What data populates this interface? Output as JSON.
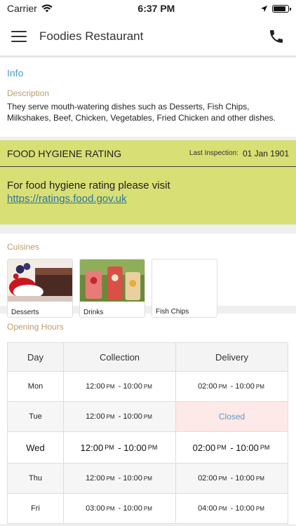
{
  "status": {
    "carrier": "Carrier",
    "time": "6:37 PM",
    "battery_level": 0.85
  },
  "nav": {
    "title": "Foodies Restaurant"
  },
  "info": {
    "title": "Info",
    "description_label": "Description",
    "description_text": "They serve mouth-watering dishes such as Desserts, Fish  Chips, Milkshakes, Beef, Chicken, Vegetables, Fried Chicken and other dishes."
  },
  "hygiene": {
    "title": "FOOD HYGIENE RATING",
    "inspection_label": "Last Inspection:",
    "inspection_date": "01 Jan 1901",
    "message": "For food hygiene rating please visit",
    "link": "https://ratings.food.gov.uk"
  },
  "cuisines": {
    "title": "Cuisines",
    "items": [
      {
        "label": "Desserts"
      },
      {
        "label": "Drinks"
      },
      {
        "label": "Fish  Chips"
      }
    ]
  },
  "hours": {
    "title": "Opening Hours",
    "headers": {
      "day": "Day",
      "collection": "Collection",
      "delivery": "Delivery"
    },
    "rows": [
      {
        "day": "Mon",
        "col_open": "12:00",
        "col_close": "10:00",
        "del_open": "02:00",
        "del_close": "10:00"
      },
      {
        "day": "Tue",
        "col_open": "12:00",
        "col_close": "10:00",
        "delivery_status": "Closed"
      },
      {
        "day": "Wed",
        "col_open": "12:00",
        "col_close": "10:00",
        "del_open": "02:00",
        "del_close": "10:00"
      },
      {
        "day": "Thu",
        "col_open": "12:00",
        "col_close": "10:00",
        "del_open": "02:00",
        "del_close": "10:00"
      },
      {
        "day": "Fri",
        "col_open": "03:00",
        "col_close": "10:00",
        "del_open": "04:00",
        "del_close": "10:00"
      }
    ],
    "pm": "PM",
    "dash": "-"
  },
  "colors": {
    "hygiene_bg": "#d8df74",
    "accent_blue": "#4aa0c8",
    "label_tan": "#b99e6c",
    "closed_bg": "#fde9e7"
  },
  "icons": [
    "wifi-icon",
    "location-arrow-icon",
    "battery-icon",
    "hamburger-menu-icon",
    "phone-icon"
  ]
}
